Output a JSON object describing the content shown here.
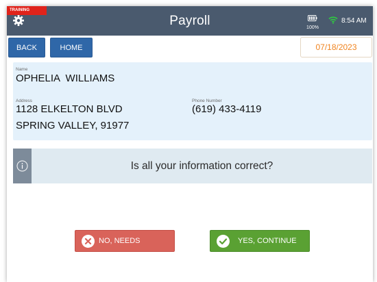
{
  "header": {
    "training_badge": "TRAINING",
    "title": "Payroll",
    "battery_percent": "100%",
    "time": "8:54 AM",
    "colors": {
      "bar": "#4a5a6e",
      "training": "#e0231b",
      "wifi": "#2ecc40"
    },
    "icons": [
      "gear-icon",
      "battery-icon",
      "wifi-icon"
    ]
  },
  "nav": {
    "back_label": "BACK",
    "home_label": "HOME",
    "date": "07/18/2023"
  },
  "employee": {
    "name_label": "Name",
    "name": "OPHELIA  WILLIAMS",
    "address_label": "Address",
    "address_line1": "1128 ELKELTON BLVD",
    "address_line2": "SPRING VALLEY, 91977",
    "phone_label": "Phone Number",
    "phone": "(619) 433-4119"
  },
  "prompt": {
    "question": "Is all your information correct?",
    "icon": "info-icon"
  },
  "actions": {
    "no_label": "NO, NEEDS CHANGES",
    "yes_label": "YES, CONTINUE",
    "colors": {
      "no": "#d9635a",
      "yes": "#5aa133"
    }
  }
}
